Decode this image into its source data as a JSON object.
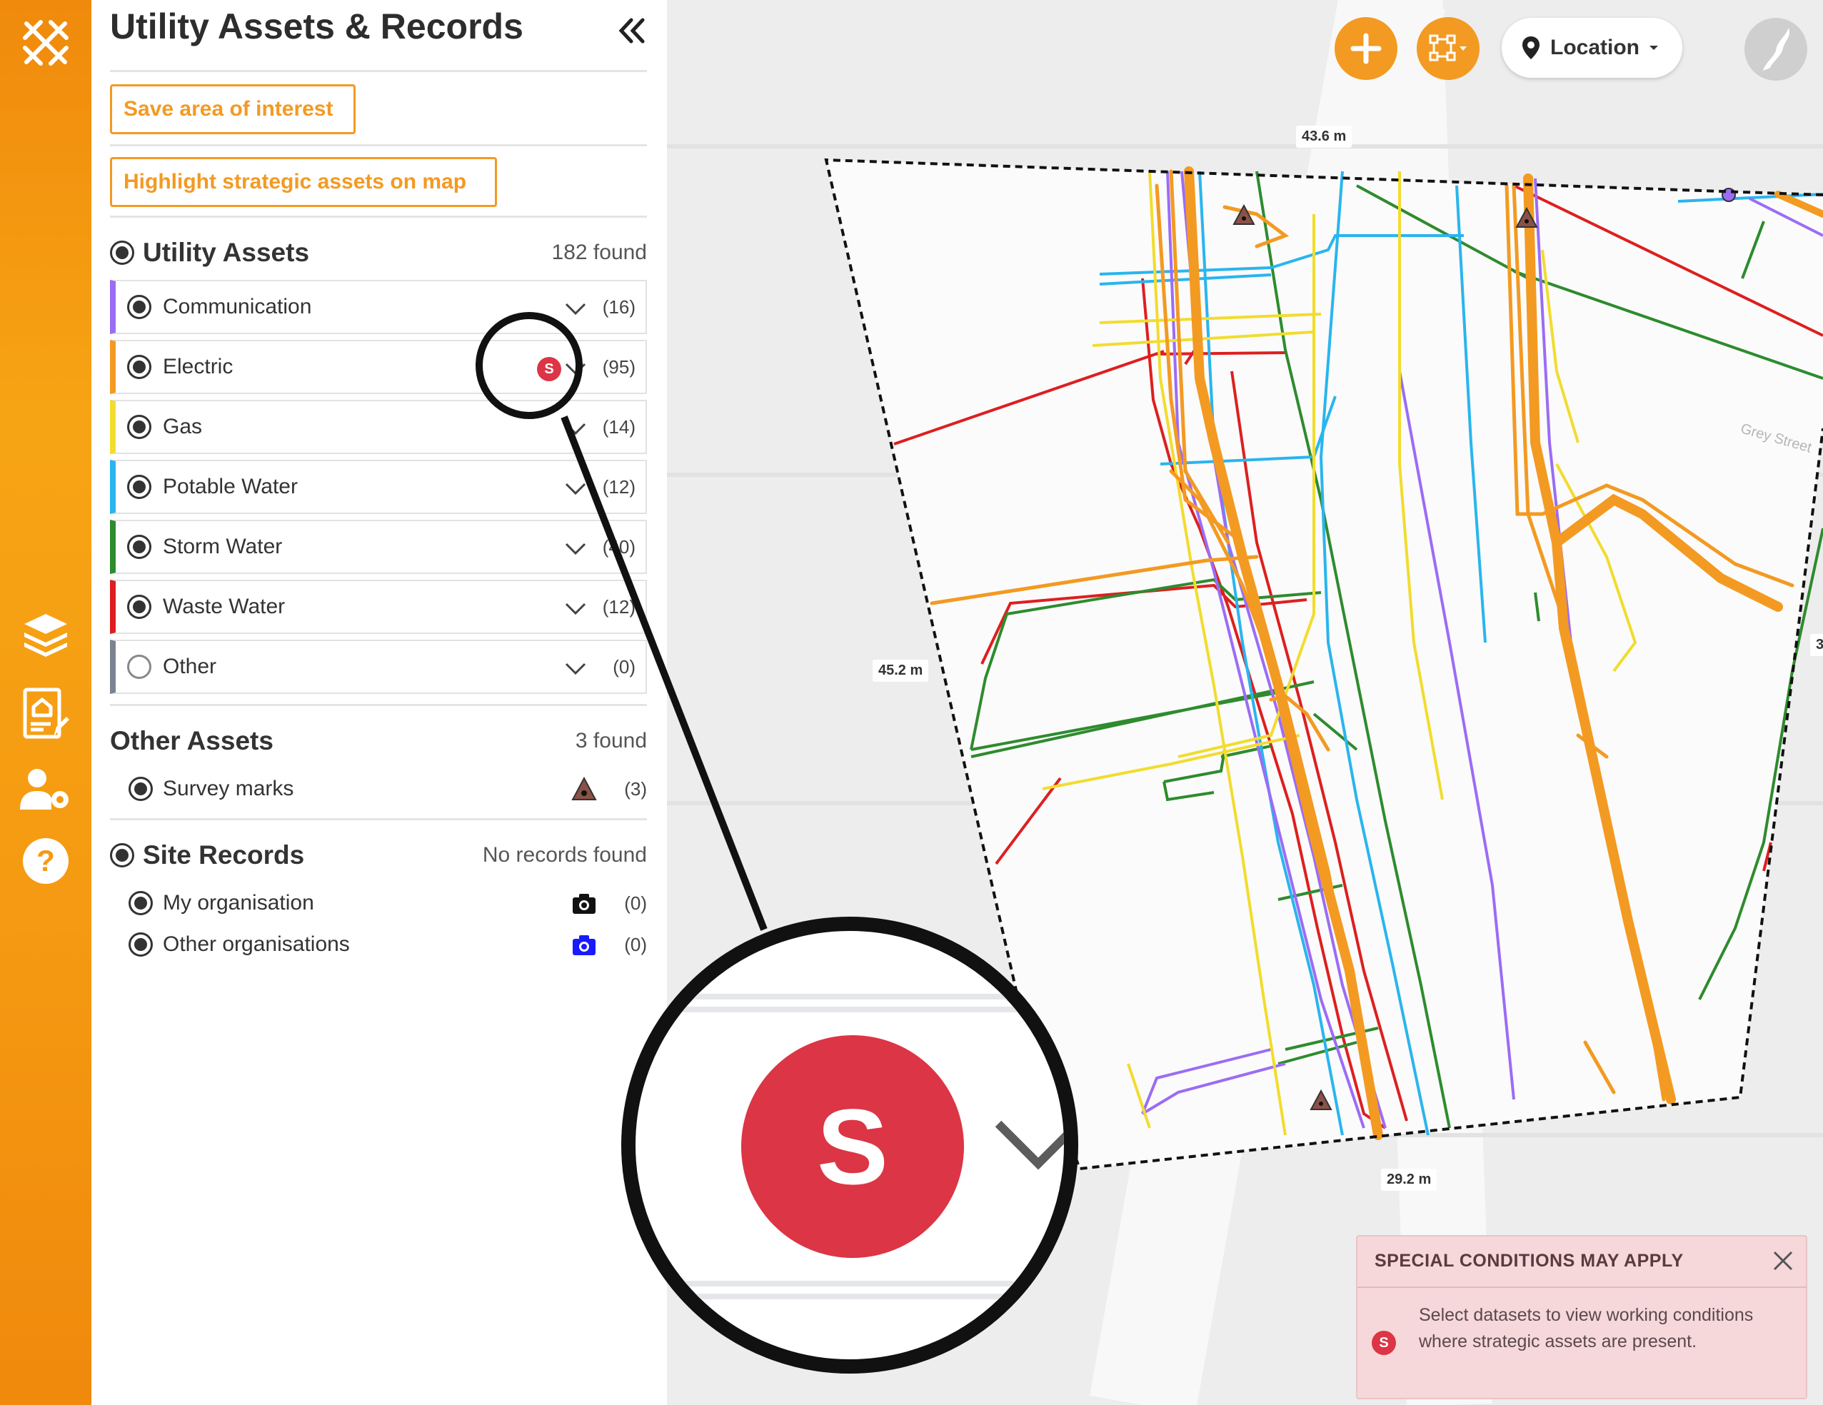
{
  "panel": {
    "title": "Utility Assets & Records",
    "buttons": {
      "save_area": "Save area of interest",
      "highlight": "Highlight strategic assets on map"
    }
  },
  "utility_assets": {
    "title": "Utility Assets",
    "count": "182 found",
    "categories": [
      {
        "label": "Communication",
        "count": "(16)",
        "color": "#9b6cf5",
        "selected": true
      },
      {
        "label": "Electric",
        "count": "(95)",
        "color": "#f39a22",
        "selected": true,
        "badge": "S"
      },
      {
        "label": "Gas",
        "count": "(14)",
        "color": "#f2dc2e",
        "selected": true
      },
      {
        "label": "Potable Water",
        "count": "(12)",
        "color": "#29b5ee",
        "selected": true
      },
      {
        "label": "Storm Water",
        "count": "(40)",
        "color": "#2e8b2e",
        "selected": true
      },
      {
        "label": "Waste Water",
        "count": "(12)",
        "color": "#dd1f1f",
        "selected": true
      },
      {
        "label": "Other",
        "count": "(0)",
        "color": "#7b8291",
        "selected": false
      }
    ]
  },
  "other_assets": {
    "title": "Other Assets",
    "count": "3 found",
    "items": [
      {
        "label": "Survey marks",
        "count": "(3)",
        "icon": "survey-mark-triangle-icon"
      }
    ]
  },
  "site_records": {
    "title": "Site Records",
    "count": "No records found",
    "items": [
      {
        "label": "My organisation",
        "count": "(0)",
        "icon": "camera-icon",
        "color": "#111111"
      },
      {
        "label": "Other organisations",
        "count": "(0)",
        "icon": "camera-icon",
        "color": "#1a1aff"
      }
    ]
  },
  "map": {
    "location_label": "Location",
    "measurements": {
      "top": "43.6 m",
      "left": "45.2 m",
      "bottom": "29.2 m",
      "right_partial": "3"
    },
    "street_label": "Grey Street",
    "line_colors": {
      "electric": "#f39a22",
      "communication": "#9b6cf5",
      "gas": "#f2dc2e",
      "potable": "#29b5ee",
      "storm": "#2e8b2e",
      "waste": "#dd1f1f"
    }
  },
  "toast": {
    "title": "SPECIAL CONDITIONS MAY APPLY",
    "badge": "S",
    "body": "Select datasets to view working conditions where strategic assets are present."
  },
  "callout": {
    "badge": "S"
  },
  "colors": {
    "accent": "#f39a22",
    "strategic": "#dc3545",
    "rail": "#f59a12"
  }
}
